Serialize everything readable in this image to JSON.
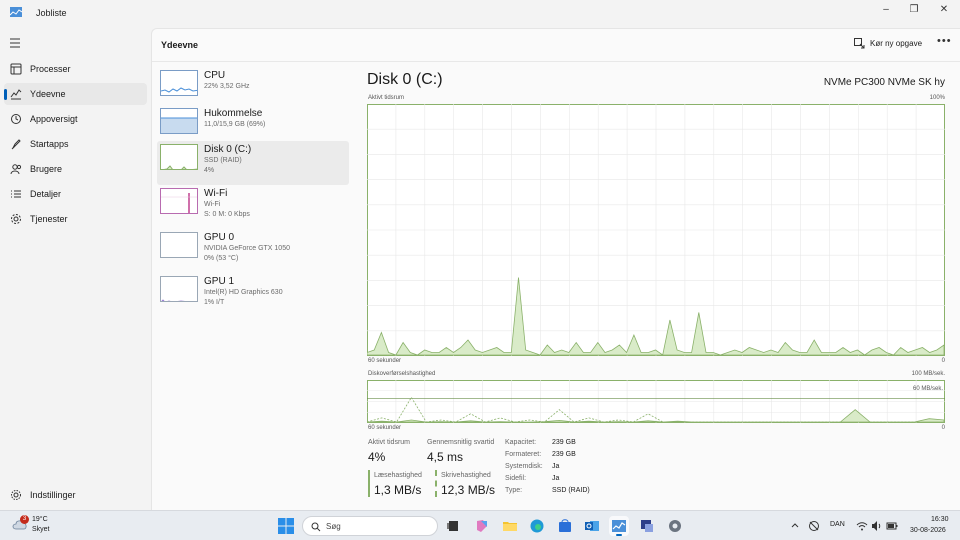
{
  "window": {
    "title": "Jobliste",
    "minimize": "‒",
    "maximize": "❐",
    "close": "✕"
  },
  "sidebar": {
    "items": [
      {
        "label": "Processer",
        "icon": "processes-icon"
      },
      {
        "label": "Ydeevne",
        "icon": "performance-icon",
        "active": true
      },
      {
        "label": "Appoversigt",
        "icon": "app-history-icon"
      },
      {
        "label": "Startapps",
        "icon": "startup-apps-icon"
      },
      {
        "label": "Brugere",
        "icon": "users-icon"
      },
      {
        "label": "Detaljer",
        "icon": "details-icon"
      },
      {
        "label": "Tjenester",
        "icon": "services-icon"
      }
    ],
    "settings_label": "Indstillinger"
  },
  "header": {
    "title": "Ydeevne",
    "run_task": "Kør ny opgave",
    "more": "•••"
  },
  "devices": [
    {
      "name": "CPU",
      "sub1": "22% 3,52 GHz",
      "sub2": ""
    },
    {
      "name": "Hukommelse",
      "sub1": "11,0/15,9 GB (69%)",
      "sub2": ""
    },
    {
      "name": "Disk 0 (C:)",
      "sub1": "SSD (RAID)",
      "sub2": "4%",
      "active": true
    },
    {
      "name": "Wi-Fi",
      "sub1": "Wi-Fi",
      "sub2": "S: 0 M: 0 Kbps"
    },
    {
      "name": "GPU 0",
      "sub1": "NVIDIA GeForce GTX 1050",
      "sub2": "0% (53 °C)"
    },
    {
      "name": "GPU 1",
      "sub1": "Intel(R) HD Graphics 630",
      "sub2": "1% I/T"
    }
  ],
  "detail": {
    "title": "Disk 0 (C:)",
    "model": "NVMe PC300 NVMe SK hy",
    "chart1_label": "Aktivt tidsrum",
    "chart1_max": "100%",
    "chart1_xleft": "60 sekunder",
    "chart1_xright": "0",
    "chart2_label": "Diskoverførselshastighed",
    "chart2_max": "100 MB/sek.",
    "chart2_mid": "60 MB/sek.",
    "chart2_xleft": "60 sekunder",
    "chart2_xright": "0"
  },
  "chart_data": {
    "type": "area",
    "title": "Aktivt tidsrum",
    "ylim": [
      0,
      100
    ],
    "x_range_seconds": [
      60,
      0
    ],
    "series": [
      {
        "values": [
          1,
          2,
          9,
          1,
          0,
          5,
          1,
          0,
          2,
          1,
          1,
          3,
          1,
          3,
          6,
          2,
          1,
          2,
          3,
          1,
          1,
          31,
          2,
          1,
          0,
          4,
          1,
          2,
          1,
          5,
          1,
          1,
          5,
          1,
          2,
          4,
          1,
          8,
          1,
          1,
          2,
          0,
          14,
          2,
          1,
          1,
          17,
          1,
          1,
          0,
          1,
          2,
          1,
          3,
          2,
          1,
          2,
          1,
          5,
          2,
          1,
          1,
          6,
          1,
          1,
          1,
          3,
          1,
          2,
          0,
          2,
          3,
          1,
          0,
          3,
          1,
          2,
          3,
          1,
          2,
          4
        ]
      }
    ]
  },
  "transfer_chart": {
    "ylim": [
      0,
      100
    ],
    "read": [
      0,
      10,
      0,
      60,
      0,
      5,
      0,
      20,
      0,
      10,
      0,
      5,
      0,
      30,
      0,
      10,
      0,
      5,
      0,
      20,
      0,
      0,
      0,
      0,
      0,
      0,
      0,
      0,
      0,
      0,
      0,
      0,
      0,
      10,
      0,
      0,
      0,
      0,
      0,
      0
    ],
    "write": [
      0,
      2,
      0,
      5,
      0,
      1,
      0,
      3,
      0,
      1,
      0,
      0,
      1,
      4,
      0,
      2,
      0,
      1,
      0,
      3,
      0,
      2,
      0,
      0,
      0,
      0,
      0,
      0,
      0,
      0,
      0,
      0,
      0,
      30,
      0,
      0,
      0,
      0,
      8,
      5
    ]
  },
  "stats": {
    "active_time_label": "Aktivt tidsrum",
    "active_time_value": "4%",
    "avg_response_label": "Gennemsnitlig svartid",
    "avg_response_value": "4,5 ms",
    "read_speed_label": "Læsehastighed",
    "read_speed_value": "1,3 MB/s",
    "write_speed_label": "Skrivehastighed",
    "write_speed_value": "12,3 MB/s",
    "props": [
      {
        "k": "Kapacitet:",
        "v": "239 GB"
      },
      {
        "k": "Formateret:",
        "v": "239 GB"
      },
      {
        "k": "Systemdisk:",
        "v": "Ja"
      },
      {
        "k": "Sidefil:",
        "v": "Ja"
      },
      {
        "k": "Type:",
        "v": "SSD (RAID)"
      }
    ]
  },
  "taskbar": {
    "weather_temp": "19°C",
    "weather_desc": "Skyet",
    "weather_badge": "3",
    "search_placeholder": "Søg",
    "language": "DAN",
    "time": "16:30",
    "date": "30-08-2026"
  },
  "colors": {
    "disk_green": "#8ab16a",
    "disk_fill": "#d9ebc8",
    "accent": "#005fb8",
    "grid": "#e8e8e8"
  }
}
